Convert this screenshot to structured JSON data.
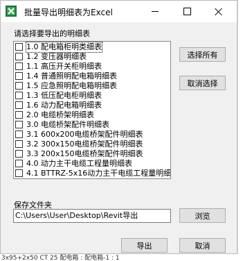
{
  "window": {
    "title": "批量导出明细表为Excel"
  },
  "labels": {
    "select_prompt": "请选择要导出的明细表",
    "save_folder": "保存文件夹"
  },
  "schedules": [
    "1.0 配电箱柜明类细表",
    "1.2 变压器明细表",
    "1.1 高压开关柜明细表",
    "1.4  普通照明配电箱明细表",
    "1.5  应急照明配电箱明细表",
    "1.3 低压配电柜明细表",
    "1.6  动力配电箱明细表",
    "2.0 电缆桥架明细表",
    "3.0 电缆桥架配件明细表",
    "3.1 600x200电缆桥架配件明细表",
    "3.2 300x150电缆桥架配件明细表",
    "3.3 200x150电缆桥架配件明细表",
    "4.0 动力主干电缆工程量明细表",
    "4.1 BTTRZ-5x16动力主干电缆工程量明细"
  ],
  "buttons": {
    "select_all": "选择所有",
    "deselect": "取消选择",
    "browse": "浏览",
    "export": "导出",
    "cancel": "取消"
  },
  "path": {
    "value": "C:\\Users\\User\\Desktop\\Revit导出"
  },
  "background": {
    "status_text": "3x95+2x50 CT 25  配电箱 : 配电箱-1 : 1"
  }
}
